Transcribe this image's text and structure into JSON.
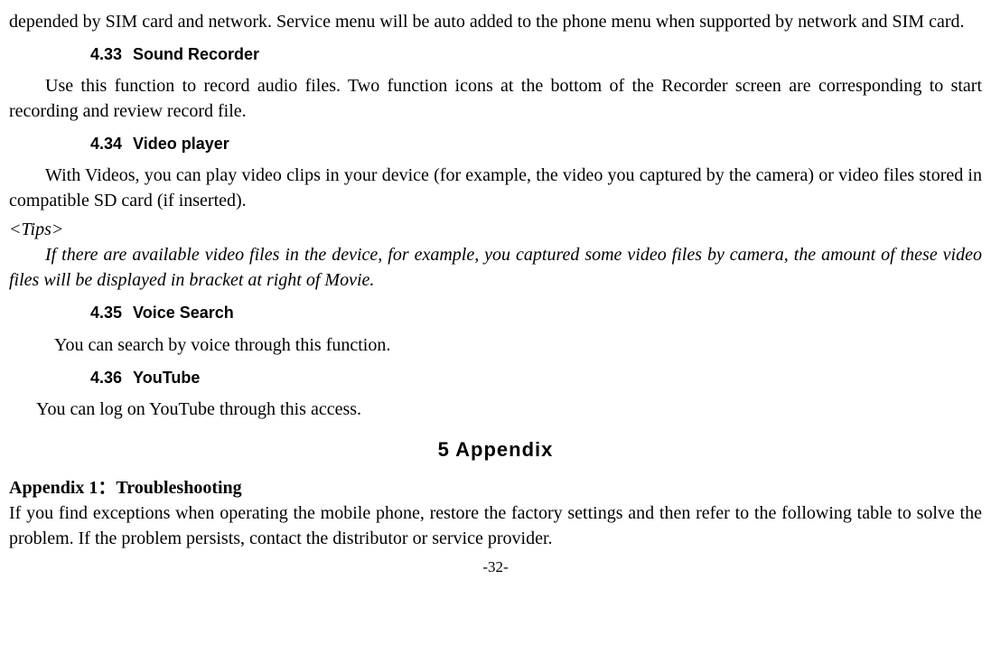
{
  "intro_para": "depended by SIM card and network. Service menu will be auto added to the phone menu when supported by network and SIM card.",
  "sections": {
    "s433": {
      "num": "4.33",
      "title": "Sound Recorder",
      "body": "Use this function to record audio files. Two function icons at the bottom of the Recorder screen are corresponding to start recording and review record file."
    },
    "s434": {
      "num": "4.34",
      "title": "Video player",
      "body": "With Videos, you can play video clips in your device (for example, the video you captured by the camera) or video files stored in compatible SD card (if inserted).",
      "tips_label": "<Tips>",
      "tips_body": "If there are available video files in the device, for example, you captured some video files by camera, the amount of these video files will be displayed in bracket at right of Movie."
    },
    "s435": {
      "num": "4.35",
      "title": "Voice Search",
      "body": "You can search by voice through this function."
    },
    "s436": {
      "num": "4.36",
      "title": "YouTube",
      "body": "You can log on YouTube through this access."
    }
  },
  "chapter": {
    "num": "5",
    "title": "Appendix"
  },
  "appendix1": {
    "title": "Appendix 1：Troubleshooting",
    "body": "If you find exceptions when operating the mobile phone, restore the factory settings and then refer to the following table to solve the problem. If the problem persists, contact the distributor or service provider."
  },
  "page_number": "-32-"
}
